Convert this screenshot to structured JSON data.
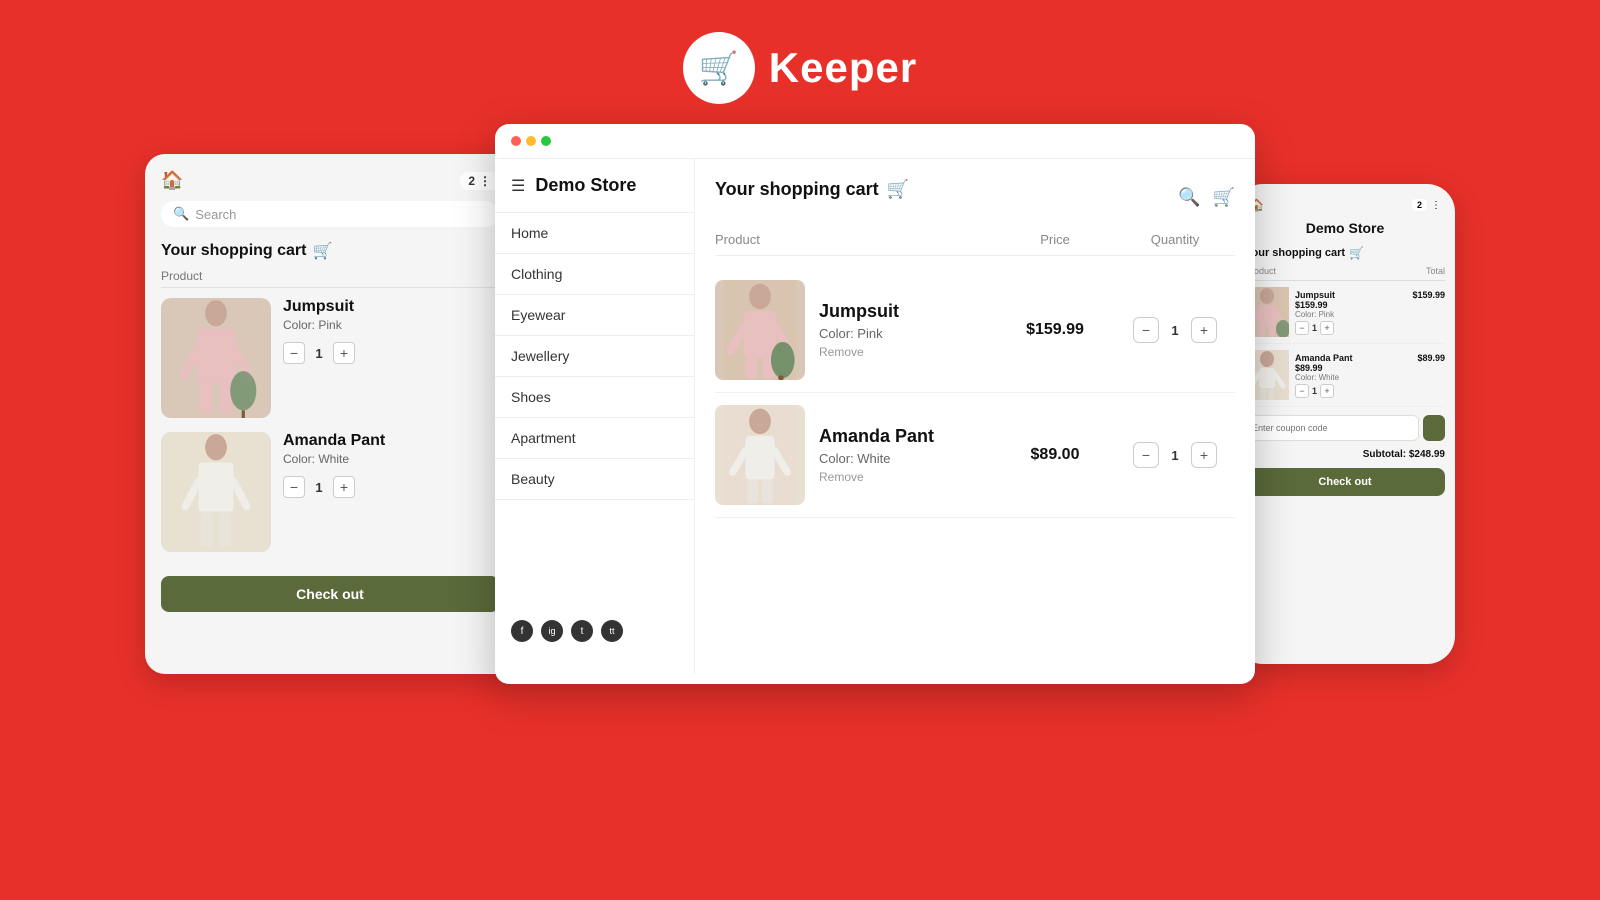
{
  "header": {
    "logo_text": "Keeper",
    "logo_icon": "🛒"
  },
  "panel_left": {
    "badge": "2",
    "search_placeholder": "Search",
    "cart_title": "Your shopping cart",
    "product_label": "Product",
    "products": [
      {
        "name": "Jumpsuit",
        "color": "Color: Pink",
        "qty": "1"
      },
      {
        "name": "Amanda Pant",
        "color": "Color: White",
        "qty": "1"
      }
    ],
    "checkout_label": "Check out"
  },
  "panel_middle": {
    "store_title": "Demo Store",
    "nav_items": [
      "Home",
      "Clothing",
      "Eyewear",
      "Jewellery",
      "Shoes",
      "Apartment",
      "Beauty"
    ],
    "social_icons": [
      "f",
      "ig",
      "tw",
      "tt"
    ],
    "cart_title": "Your shopping cart",
    "col_product": "Product",
    "col_price": "Price",
    "col_quantity": "Quantity",
    "products": [
      {
        "name": "Jumpsuit",
        "color": "Color: Pink",
        "remove": "Remove",
        "price": "$159.99",
        "qty": "1"
      },
      {
        "name": "Amanda Pant",
        "color": "Color: White",
        "remove": "Remove",
        "price": "$89.00",
        "qty": "1"
      }
    ]
  },
  "panel_right": {
    "store_title": "Demo Store",
    "cart_title": "Your shopping cart",
    "col_product": "Product",
    "col_total": "Total",
    "products": [
      {
        "name": "Jumpsuit",
        "price": "$159.99",
        "price2": "$159.99",
        "color": "Color: Pink",
        "qty": "1"
      },
      {
        "name": "Amanda Pant",
        "price": "$89.99",
        "price2": "$89.99",
        "color": "Color: White",
        "qty": "1"
      }
    ],
    "coupon_placeholder": "Enter coupon code",
    "subtotal": "Subtotal: $248.99",
    "checkout_label": "Check out"
  }
}
